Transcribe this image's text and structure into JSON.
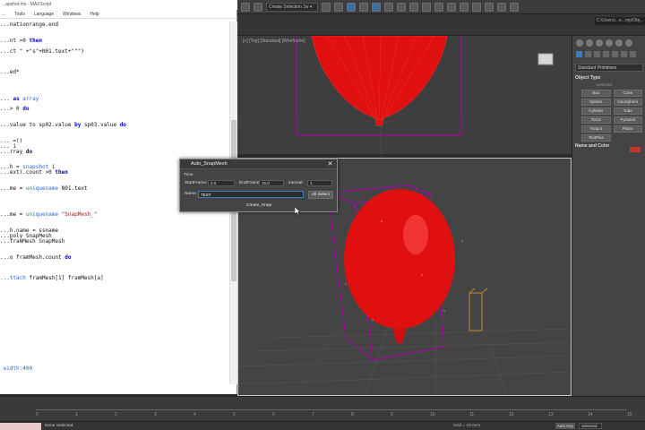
{
  "editor": {
    "title": "...apshot.ms - MAXScript",
    "menu": [
      "...",
      "Tools",
      "Language",
      "Windows",
      "Help"
    ],
    "code_lines": [
      {
        "segments": [
          {
            "t": "...nationrange.end",
            "c": ""
          }
        ]
      },
      {
        "segments": []
      },
      {
        "segments": []
      },
      {
        "segments": [
          {
            "t": "...nt >0 ",
            "c": ""
          },
          {
            "t": "then",
            "c": "kw"
          }
        ]
      },
      {
        "segments": []
      },
      {
        "segments": [
          {
            "t": "...ct \" +\"s\"+N01.text+\"\"\")",
            "c": ""
          }
        ]
      },
      {
        "segments": []
      },
      {
        "segments": []
      },
      {
        "segments": []
      },
      {
        "segments": [
          {
            "t": "...ed*",
            "c": ""
          }
        ]
      },
      {
        "segments": []
      },
      {
        "segments": []
      },
      {
        "segments": []
      },
      {
        "segments": []
      },
      {
        "segments": [
          {
            "t": "...",
            "c": ""
          },
          {
            "t": " as ",
            "c": "kw"
          },
          {
            "t": "array",
            "c": "fn"
          }
        ]
      },
      {
        "segments": []
      },
      {
        "segments": [
          {
            "t": "...> 0 ",
            "c": ""
          },
          {
            "t": "do",
            "c": "kw"
          }
        ]
      },
      {
        "segments": []
      },
      {
        "segments": []
      },
      {
        "segments": [
          {
            "t": "...value to sp02.value ",
            "c": ""
          },
          {
            "t": "by",
            "c": "kw"
          },
          {
            "t": " sp03.value ",
            "c": ""
          },
          {
            "t": "do",
            "c": "kw"
          }
        ]
      },
      {
        "segments": []
      },
      {
        "segments": []
      },
      {
        "segments": [
          {
            "t": "... =()",
            "c": ""
          }
        ]
      },
      {
        "segments": [
          {
            "t": "... i",
            "c": ""
          }
        ]
      },
      {
        "segments": [
          {
            "t": "...rray ",
            "c": ""
          },
          {
            "t": "do",
            "c": "kw"
          }
        ]
      },
      {
        "segments": []
      },
      {
        "segments": []
      },
      {
        "segments": [
          {
            "t": "...h = ",
            "c": ""
          },
          {
            "t": "snapshot",
            "c": "fn"
          },
          {
            "t": " i",
            "c": ""
          }
        ]
      },
      {
        "segments": [
          {
            "t": "...ext).count >0 ",
            "c": ""
          },
          {
            "t": "then",
            "c": "kw"
          }
        ]
      },
      {
        "segments": []
      },
      {
        "segments": []
      },
      {
        "segments": [
          {
            "t": "...me = ",
            "c": ""
          },
          {
            "t": "uniquename",
            "c": "fn"
          },
          {
            "t": " N01.text",
            "c": ""
          }
        ]
      },
      {
        "segments": []
      },
      {
        "segments": []
      },
      {
        "segments": []
      },
      {
        "segments": []
      },
      {
        "segments": [
          {
            "t": "...me = ",
            "c": ""
          },
          {
            "t": "uniquename",
            "c": "fn"
          },
          {
            "t": " \"SnapMesh_\"",
            "c": "str"
          }
        ]
      },
      {
        "segments": []
      },
      {
        "segments": []
      },
      {
        "segments": [
          {
            "t": "...h.name = ssname",
            "c": ""
          }
        ]
      },
      {
        "segments": [
          {
            "t": "...poly SnapMesh",
            "c": ""
          }
        ]
      },
      {
        "segments": [
          {
            "t": "...framMesh SnapMesh",
            "c": ""
          }
        ]
      },
      {
        "segments": []
      },
      {
        "segments": []
      },
      {
        "segments": [
          {
            "t": "...o framMesh.count ",
            "c": ""
          },
          {
            "t": "do",
            "c": "kw"
          }
        ]
      },
      {
        "segments": []
      },
      {
        "segments": []
      },
      {
        "segments": []
      },
      {
        "segments": [
          {
            "t": "...ttach",
            "c": "fn"
          },
          {
            "t": " framMesh[1] framMesh[a]",
            "c": ""
          }
        ]
      },
      {
        "segments": []
      },
      {
        "segments": []
      },
      {
        "segments": []
      },
      {
        "segments": []
      },
      {
        "segments": []
      },
      {
        "segments": []
      },
      {
        "segments": []
      },
      {
        "segments": []
      },
      {
        "segments": []
      },
      {
        "segments": []
      },
      {
        "segments": []
      },
      {
        "segments": []
      },
      {
        "segments": []
      },
      {
        "segments": []
      },
      {
        "segments": []
      },
      {
        "segments": []
      },
      {
        "segments": [
          {
            "t": " width:400",
            "c": "fn"
          }
        ]
      }
    ]
  },
  "toolbar": {
    "selection_set": "Create Selection Se ▾",
    "path": "C:\\Users\\...e...mp\\Obj..."
  },
  "viewports": {
    "top_label": "[+] [Top] [Standard] [Wireframe]",
    "persp_label": ""
  },
  "command_panel": {
    "dropdown": "Standard Primitives",
    "object_type": "Object Type",
    "autogrid": "AutoGrid",
    "buttons": [
      "Box",
      "Cone",
      "Sphere",
      "GeoSphere",
      "Cylinder",
      "Tube",
      "Torus",
      "Pyramid",
      "Teapot",
      "Plane",
      "TextPlus"
    ],
    "name_color": "Name and Color"
  },
  "dialog": {
    "title": "Auto_SnapMesh",
    "close": "✕",
    "time_group": "Time",
    "start_label": "StartFrame:",
    "start_value": "0.0",
    "end_label": "EndFrame:",
    "end_value": "15.0",
    "interval_label": "interval:",
    "interval_value": "1",
    "name_label": "Name:",
    "name_value": "TEST",
    "all_select": "All Select",
    "create_snap": "Create_Snap"
  },
  "timeline": {
    "ticks": [
      "0",
      "1",
      "2",
      "3",
      "4",
      "5",
      "6",
      "7",
      "8",
      "9",
      "10",
      "11",
      "12",
      "13",
      "14",
      "15"
    ]
  },
  "status": {
    "text": "None Selected",
    "grid": "Grid = 10.0cm",
    "autokey": "Auto Key",
    "selected": "Selected"
  },
  "colors": {
    "balloon": "#e01010",
    "selection_box": "#b000b0",
    "accent": "#3a7bc2"
  }
}
